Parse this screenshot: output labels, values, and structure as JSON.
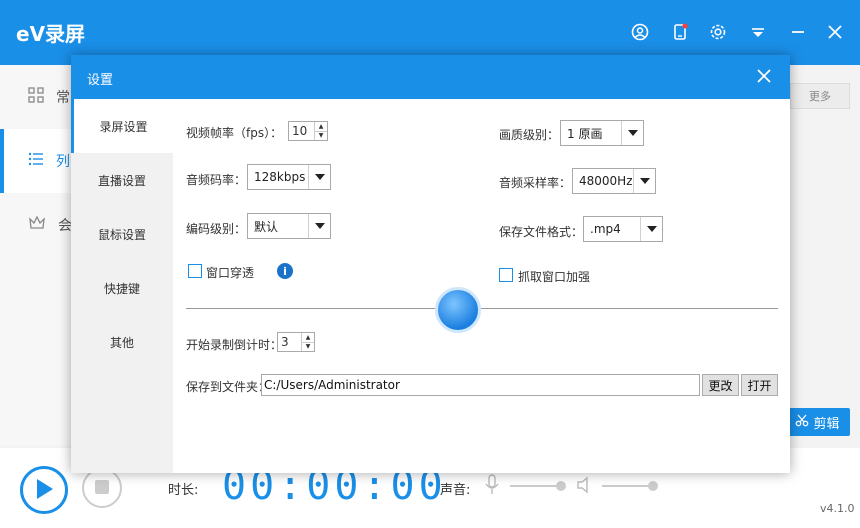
{
  "app": {
    "logo": "eV录屏",
    "version": "v4.1.0"
  },
  "nav": {
    "items": [
      {
        "label": "常",
        "icon": "grid-icon"
      },
      {
        "label": "列",
        "icon": "list-icon"
      },
      {
        "label": "会",
        "icon": "crown-icon"
      }
    ]
  },
  "list": {
    "more_label": "更多",
    "edit_label": "剪辑"
  },
  "bottom": {
    "duration_label": "时长:",
    "timer": "00:00:00",
    "sound_label": "声音:"
  },
  "dialog": {
    "title": "设置",
    "tabs": [
      "录屏设置",
      "直播设置",
      "鼠标设置",
      "快捷键",
      "其他"
    ],
    "fps_label": "视频帧率（fps）：",
    "fps_value": "10",
    "quality_label": "画质级别：",
    "quality_value": "1 原画",
    "audio_bitrate_label": "音频码率：",
    "audio_bitrate_value": "128kbps",
    "sample_rate_label": "音频采样率：",
    "sample_rate_value": "48000Hz",
    "encode_label": "编码级别：",
    "encode_value": "默认",
    "format_label": "保存文件格式：",
    "format_value": ".mp4",
    "window_through_label": "窗口穿透",
    "capture_enhance_label": "抓取窗口加强",
    "countdown_label": "开始录制倒计时：",
    "countdown_value": "3",
    "save_folder_label": "保存到文件夹：",
    "save_folder_value": "C:/Users/Administrator",
    "change_label": "更改",
    "open_label": "打开"
  }
}
